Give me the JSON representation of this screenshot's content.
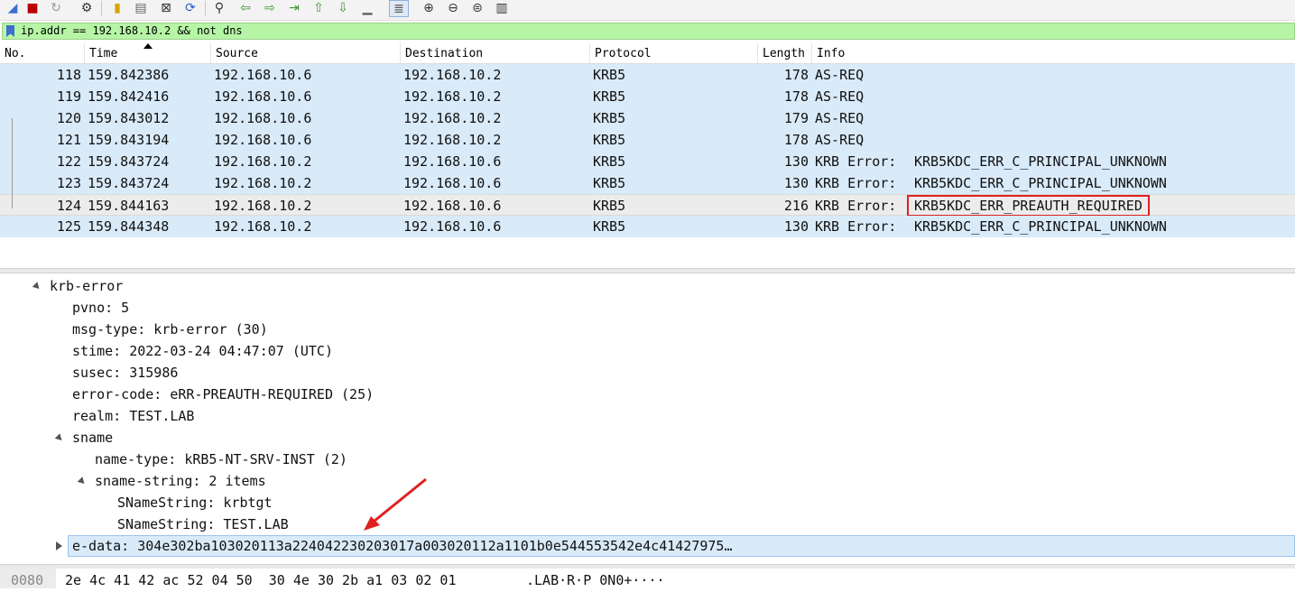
{
  "filter": {
    "text": "ip.addr == 192.168.10.2 && not dns"
  },
  "packet_list": {
    "columns": [
      "No.",
      "Time",
      "Source",
      "Destination",
      "Protocol",
      "Length",
      "Info"
    ],
    "rows": [
      {
        "no": "118",
        "time": "159.842386",
        "src": "192.168.10.6",
        "dst": "192.168.10.2",
        "proto": "KRB5",
        "len": "178",
        "info": "AS-REQ",
        "info_detail": ""
      },
      {
        "no": "119",
        "time": "159.842416",
        "src": "192.168.10.6",
        "dst": "192.168.10.2",
        "proto": "KRB5",
        "len": "178",
        "info": "AS-REQ",
        "info_detail": ""
      },
      {
        "no": "120",
        "time": "159.843012",
        "src": "192.168.10.6",
        "dst": "192.168.10.2",
        "proto": "KRB5",
        "len": "179",
        "info": "AS-REQ",
        "info_detail": ""
      },
      {
        "no": "121",
        "time": "159.843194",
        "src": "192.168.10.6",
        "dst": "192.168.10.2",
        "proto": "KRB5",
        "len": "178",
        "info": "AS-REQ",
        "info_detail": ""
      },
      {
        "no": "122",
        "time": "159.843724",
        "src": "192.168.10.2",
        "dst": "192.168.10.6",
        "proto": "KRB5",
        "len": "130",
        "info": "KRB Error:",
        "info_detail": "KRB5KDC_ERR_C_PRINCIPAL_UNKNOWN"
      },
      {
        "no": "123",
        "time": "159.843724",
        "src": "192.168.10.2",
        "dst": "192.168.10.6",
        "proto": "KRB5",
        "len": "130",
        "info": "KRB Error:",
        "info_detail": "KRB5KDC_ERR_C_PRINCIPAL_UNKNOWN"
      },
      {
        "no": "124",
        "time": "159.844163",
        "src": "192.168.10.2",
        "dst": "192.168.10.6",
        "proto": "KRB5",
        "len": "216",
        "info": "KRB Error:",
        "info_detail": "KRB5KDC_ERR_PREAUTH_REQUIRED"
      },
      {
        "no": "125",
        "time": "159.844348",
        "src": "192.168.10.2",
        "dst": "192.168.10.6",
        "proto": "KRB5",
        "len": "130",
        "info": "KRB Error:",
        "info_detail": "KRB5KDC_ERR_C_PRINCIPAL_UNKNOWN"
      }
    ]
  },
  "details": {
    "krb_error": "krb-error",
    "pvno": "pvno: 5",
    "msg_type": "msg-type: krb-error (30)",
    "stime": "stime: 2022-03-24 04:47:07 (UTC)",
    "susec": "susec: 315986",
    "error_code": "error-code: eRR-PREAUTH-REQUIRED (25)",
    "realm": "realm: TEST.LAB",
    "sname": "sname",
    "name_type": "name-type: kRB5-NT-SRV-INST (2)",
    "sname_string": "sname-string: 2 items",
    "sname_string_1": "SNameString: krbtgt",
    "sname_string_2": "SNameString: TEST.LAB",
    "e_data": "e-data: 304e302ba103020113a224042230203017a003020112a1101b0e544553542e4c41427975…"
  },
  "bytes": {
    "offset": "0080",
    "hex": "2e 4c 41 42 ac 52 04 50  30 4e 30 2b a1 03 02 01",
    "ascii": ".LAB·R·P 0N0+····"
  },
  "colors": {
    "row": "#d9eaf9",
    "selected_row": "#ececec",
    "filter_bg": "#b5f5a5",
    "highlight_box": "#e02020",
    "arrow": "#e02020"
  },
  "toolbar_icons": [
    "shark-fin-icon",
    "stop-icon",
    "restart-icon",
    "options-icon",
    "open-icon",
    "save-icon",
    "close-icon",
    "reload-icon",
    "find-icon",
    "back-icon",
    "forward-icon",
    "go-to-packet-icon",
    "first-packet-icon",
    "last-packet-icon",
    "autoscroll-icon",
    "colorize-icon",
    "zoom-in-icon",
    "zoom-out-icon",
    "zoom-normal-icon",
    "resize-columns-icon"
  ]
}
